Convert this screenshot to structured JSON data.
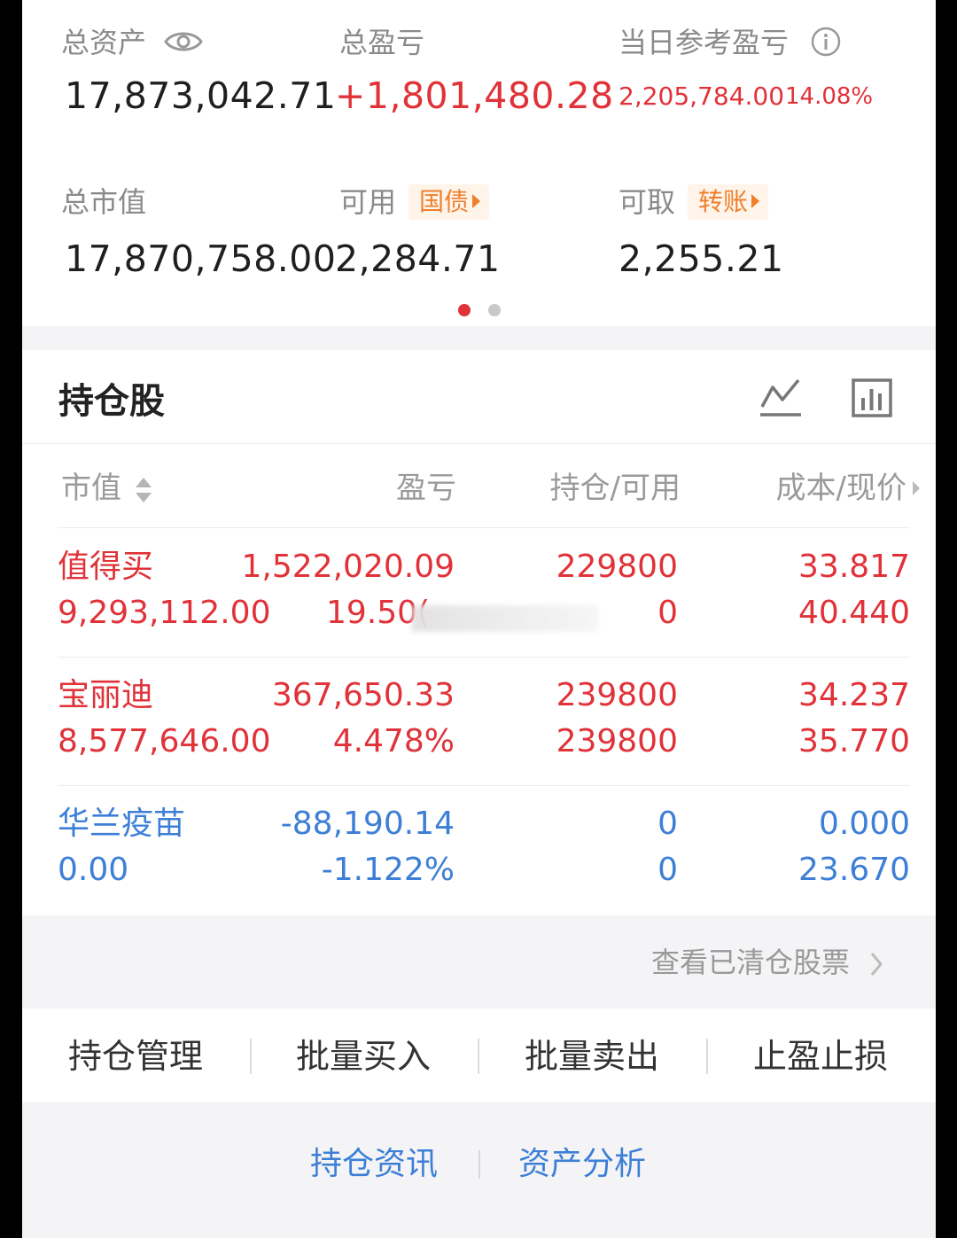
{
  "summary": {
    "total_assets_label": "总资产",
    "total_assets_value": "17,873,042.71",
    "total_pnl_label": "总盈亏",
    "total_pnl_value": "+1,801,480.28",
    "today_pnl_label": "当日参考盈亏",
    "today_pnl_value": "2,205,784.00",
    "today_pnl_pct": "14.08%",
    "market_value_label": "总市值",
    "market_value_value": "17,870,758.00",
    "available_label": "可用",
    "available_tag": "国债",
    "available_value": "2,284.71",
    "withdrawable_label": "可取",
    "withdrawable_tag": "转账",
    "withdrawable_value": "2,255.21"
  },
  "holdings": {
    "title": "持仓股",
    "columns": [
      "市值",
      "盈亏",
      "持仓/可用",
      "成本/现价"
    ],
    "rows": [
      {
        "name": "值得买",
        "market_value": "9,293,112.00",
        "pnl": "1,522,020.09",
        "pnl_pct": "19.50(",
        "position": "229800",
        "available": "0",
        "cost": "33.817",
        "price": "40.440",
        "tone": "red"
      },
      {
        "name": "宝丽迪",
        "market_value": "8,577,646.00",
        "pnl": "367,650.33",
        "pnl_pct": "4.478%",
        "position": "239800",
        "available": "239800",
        "cost": "34.237",
        "price": "35.770",
        "tone": "red"
      },
      {
        "name": "华兰疫苗",
        "market_value": "0.00",
        "pnl": "-88,190.14",
        "pnl_pct": "-1.122%",
        "position": "0",
        "available": "0",
        "cost": "0.000",
        "price": "23.670",
        "tone": "blue"
      }
    ],
    "cleared_link": "查看已清仓股票"
  },
  "actions": [
    "持仓管理",
    "批量买入",
    "批量卖出",
    "止盈止损"
  ],
  "bottom_links": [
    "持仓资讯",
    "资产分析"
  ],
  "colors": {
    "red": "#e03238",
    "blue": "#3d7fd6",
    "orange": "#ef7f2c"
  }
}
